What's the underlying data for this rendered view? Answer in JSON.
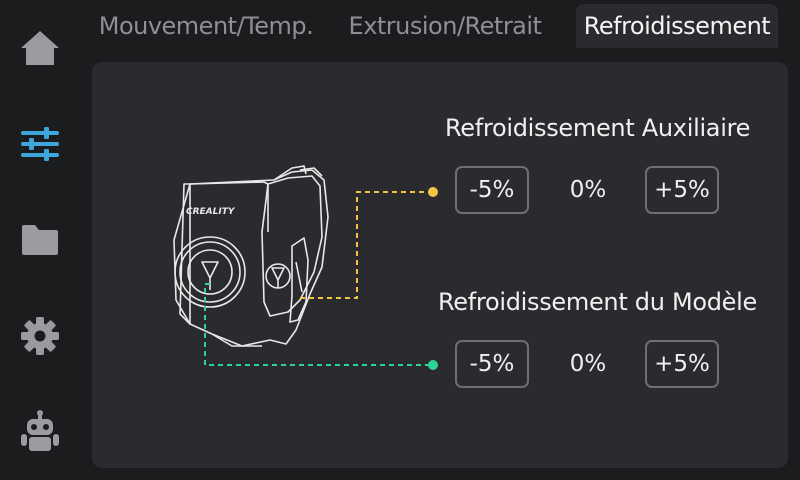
{
  "sidebar": {
    "items": [
      {
        "name": "home-icon"
      },
      {
        "name": "sliders-icon",
        "active": true
      },
      {
        "name": "folder-icon"
      },
      {
        "name": "gear-icon"
      },
      {
        "name": "robot-icon"
      }
    ]
  },
  "tabs": [
    {
      "label": "Mouvement/Temp.",
      "active": false
    },
    {
      "label": "Extrusion/Retrait",
      "active": false
    },
    {
      "label": "Refroidissement",
      "active": true
    }
  ],
  "auxiliary_fan": {
    "title": "Refroidissement Auxiliaire",
    "decrease_label": "-5%",
    "value": "0%",
    "increase_label": "+5%"
  },
  "model_fan": {
    "title": "Refroidissement du Modèle",
    "decrease_label": "-5%",
    "value": "0%",
    "increase_label": "+5%"
  },
  "printhead": {
    "brand_text": "CREALITY"
  },
  "colors": {
    "background": "#1b1c1e",
    "panel": "#2a2b2e",
    "accent_blue": "#3ea6dc",
    "icon_gray": "#9a9b9e",
    "auxiliary_line": "#f5c542",
    "model_line": "#2ed39a"
  }
}
